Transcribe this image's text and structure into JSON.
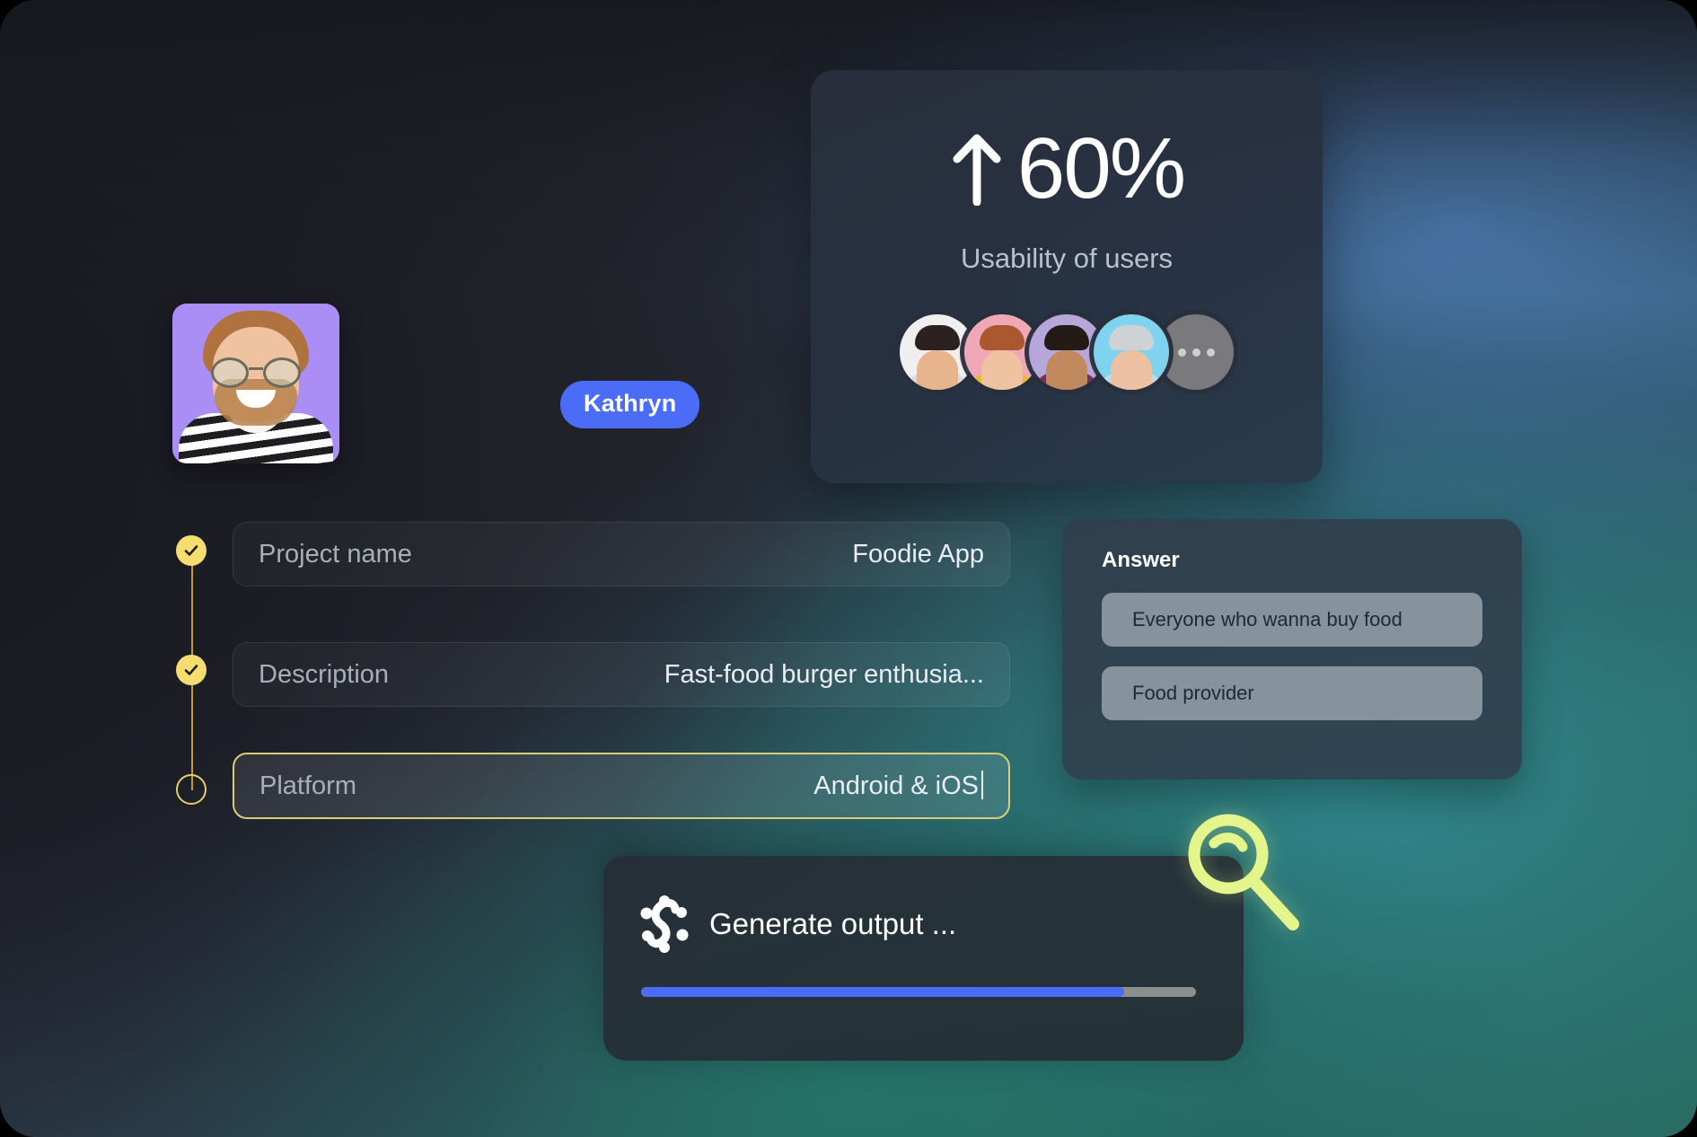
{
  "usability": {
    "trend_icon": "arrow-up-icon",
    "percent": "60%",
    "caption": "Usability of users",
    "avatars": [
      {
        "name": "avatar-1",
        "bg": "#f1eef0",
        "skin": "#e8b48c",
        "hair": "#2a2120",
        "body": "#d9d9de"
      },
      {
        "name": "avatar-2",
        "bg": "#f0a8b6",
        "skin": "#f0c3a0",
        "hair": "#a9582f",
        "body": "#e8b933"
      },
      {
        "name": "avatar-3",
        "bg": "#b7a6da",
        "skin": "#c08a5e",
        "hair": "#241b17",
        "body": "#7c2c55"
      },
      {
        "name": "avatar-4",
        "bg": "#7fd3ee",
        "skin": "#ecc0a0",
        "hair": "#cfd2d4",
        "body": "#bcdcee"
      }
    ],
    "more_label": "more-avatars"
  },
  "profile": {
    "alt": "user-profile-photo"
  },
  "name_tag": {
    "label": "Kathryn"
  },
  "timeline": {
    "steps": [
      {
        "name": "step-project-name",
        "state": "done"
      },
      {
        "name": "step-description",
        "state": "done"
      },
      {
        "name": "step-platform",
        "state": "pending"
      }
    ]
  },
  "form": {
    "rows": [
      {
        "label": "Project name",
        "value": "Foodie App"
      },
      {
        "label": "Description",
        "value": "Fast-food burger enthusia..."
      },
      {
        "label": "Platform",
        "value": "Android & iOS"
      }
    ]
  },
  "answer": {
    "title": "Answer",
    "options": [
      "Everyone who wanna buy food",
      "Food provider"
    ]
  },
  "generate": {
    "icon": "spiral-logo-icon",
    "label": "Generate output ...",
    "progress_percent": 87
  },
  "cursor": {
    "magnifier": "magnifier-icon",
    "pointer": "pointer-arrow-icon"
  },
  "colors": {
    "accent_blue": "#4a6cf7",
    "accent_yellow": "#f5dd72",
    "highlight_border": "#d9cf7a",
    "magnifier": "#e4f58c",
    "card_bg": "#2c3440",
    "canvas_bg": "#23242c"
  }
}
